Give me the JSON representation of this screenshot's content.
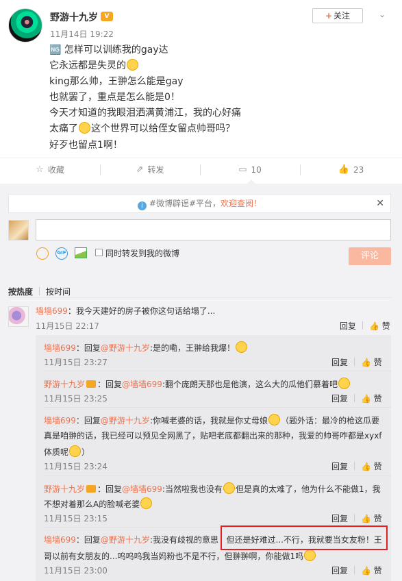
{
  "post": {
    "author": "野游十九岁",
    "time": "11月14日 19:22",
    "follow_label": "关注",
    "lines": [
      "🆖 怎样可以训练我的gay达",
      "它永远都是失灵的",
      "king那么帅，王翀怎么能是gay",
      "也就罢了，重点是怎么能是0！",
      "今天才知道的我眼泪洒满黄浦江，我的心好痛",
      "太痛了",
      "这个世界可以给侄女留点帅哥吗？",
      "好歹也留点1啊！"
    ]
  },
  "actions": {
    "favorite": "收藏",
    "repost": "转发",
    "comment_count": "10",
    "like_count": "23"
  },
  "notice": {
    "text_before": "#微博辟谣#平台，",
    "link": "欢迎查阅！"
  },
  "composer": {
    "repost_label": "同时转发到我的微博",
    "submit": "评论"
  },
  "sort": {
    "hot": "按热度",
    "time": "按时间"
  },
  "comment": {
    "user": "墙墙699",
    "text": "：我今天建好的房子被你这句话给塌了...",
    "time": "11月15日 22:17",
    "reply": "回复",
    "like": "赞"
  },
  "replies": [
    {
      "user": "墙墙699",
      "reply_word": "：回复",
      "target": "@野游十九岁",
      "lines": [
        ":是的嘞，王翀给我爆！"
      ],
      "time": "11月15日 23:27"
    },
    {
      "user": "野游十九岁",
      "reply_word": "：回复",
      "target": "@墙墙699",
      "lines": [
        ":翻个庞朗天那也是他演，这么大的瓜他们慕着吧"
      ],
      "time": "11月15日 23:25"
    },
    {
      "user": "墙墙699",
      "reply_word": "：回复",
      "target": "@野游十九岁",
      "lines": [
        ":你喊老婆的话，我就是你丈母娘",
        "（题外话：最冷的枪这瓜要",
        "真是咱翀的话，我已经可以预见全网黑了，贴吧老底都翻出来的那种，我爱的帅哥咋都是xyxf",
        "体质呢",
        "）"
      ],
      "time": "11月15日 23:24"
    },
    {
      "user": "野游十九岁",
      "reply_word": "：回复",
      "target": "@墙墙699",
      "lines": [
        ":当然啦我也没有",
        "但是真的太难了，他为什么不能做1，我",
        "不想对着那么A的脸喊老婆"
      ],
      "time": "11月15日 23:15"
    },
    {
      "user": "墙墙699",
      "reply_word": "：回复",
      "target": "@野游十九岁",
      "lines": [
        ":我没有歧视的意思",
        "但还是好难过...不行，我就要当女友粉！王",
        "哥以前有女朋友的...呜呜呜我当妈粉也不是不行，但翀翀啊，你能做1吗"
      ],
      "time": "11月15日 23:00"
    }
  ],
  "colors": {
    "link": "#eb7350",
    "highlight": "#e02020"
  }
}
